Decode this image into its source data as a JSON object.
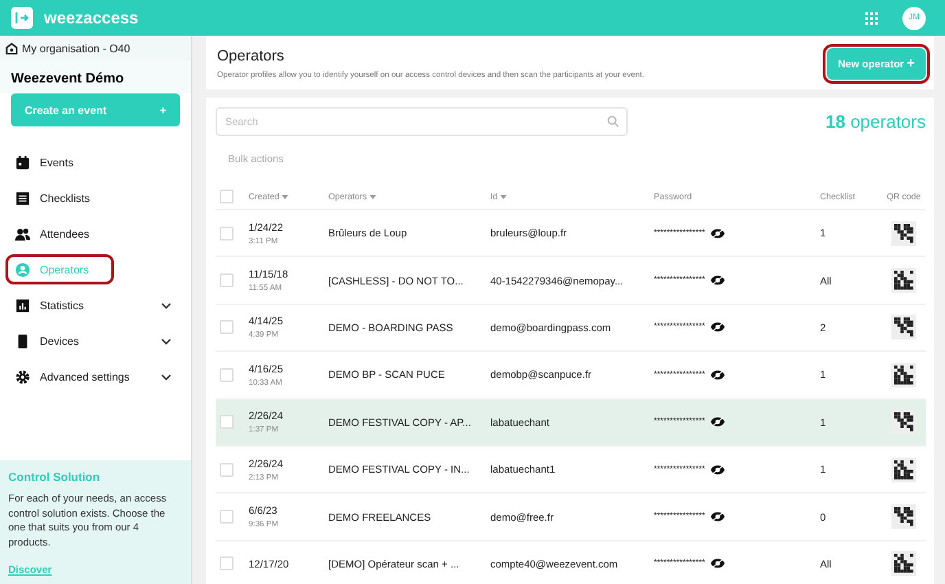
{
  "topbar": {
    "logo_text": "weezaccess",
    "avatar": "JM"
  },
  "sidebar": {
    "organisation": "My organisation - O40",
    "event_name": "Weezevent Démo",
    "create_button": "Create an event",
    "create_icon": "+",
    "items": [
      {
        "label": "Events",
        "kind": "link",
        "selected": false,
        "highlighted": false
      },
      {
        "label": "Checklists",
        "kind": "link",
        "selected": false,
        "highlighted": false
      },
      {
        "label": "Attendees",
        "kind": "link",
        "selected": false,
        "highlighted": false
      },
      {
        "label": "Operators",
        "kind": "link",
        "selected": true,
        "highlighted": true
      },
      {
        "label": "Statistics",
        "kind": "group",
        "selected": false,
        "highlighted": false
      },
      {
        "label": "Devices",
        "kind": "group",
        "selected": false,
        "highlighted": false
      },
      {
        "label": "Advanced settings",
        "kind": "group",
        "selected": false,
        "highlighted": false
      }
    ],
    "promo": {
      "title": "Control Solution",
      "text": "For each of your needs, an access control solution exists. Choose the one that suits you from our 4 products.",
      "link": "Discover"
    }
  },
  "header": {
    "title": "Operators",
    "description": "Operator profiles allow you to identify yourself on our access control devices and then scan the participants at your event.",
    "new_button": {
      "label": "New operator",
      "icon": "+",
      "highlighted": true
    }
  },
  "toolbar": {
    "search": {
      "placeholder": "Search"
    },
    "count": "18",
    "count_label": "operators",
    "bulk_actions": "Bulk actions"
  },
  "table": {
    "columns": [
      "Created",
      "Operators",
      "Id",
      "Password",
      "Checklist",
      "QR code"
    ],
    "header_checked": false,
    "rows": [
      {
        "date": "1/24/22",
        "time": "3:11 PM",
        "operator": "Brûleurs de Loup",
        "id": "bruleurs@loup.fr",
        "password": "****************",
        "checklist": "1",
        "checked": false,
        "selected": false
      },
      {
        "date": "11/15/18",
        "time": "11:55 AM",
        "operator": "[CASHLESS] - DO NOT TO...",
        "id": "40-1542279346@nemopay...",
        "password": "****************",
        "checklist": "All",
        "checked": false,
        "selected": false
      },
      {
        "date": "4/14/25",
        "time": "4:39 PM",
        "operator": "DEMO - BOARDING PASS",
        "id": "demo@boardingpass.com",
        "password": "****************",
        "checklist": "2",
        "checked": false,
        "selected": false
      },
      {
        "date": "4/16/25",
        "time": "10:33 AM",
        "operator": "DEMO BP - SCAN PUCE",
        "id": "demobp@scanpuce.fr",
        "password": "****************",
        "checklist": "1",
        "checked": false,
        "selected": false
      },
      {
        "date": "2/26/24",
        "time": "1:37 PM",
        "operator": "DEMO FESTIVAL COPY - AP...",
        "id": "labatuechant",
        "password": "****************",
        "checklist": "1",
        "checked": false,
        "selected": true
      },
      {
        "date": "2/26/24",
        "time": "2:13 PM",
        "operator": "DEMO FESTIVAL COPY - IN...",
        "id": "labatuechant1",
        "password": "****************",
        "checklist": "1",
        "checked": false,
        "selected": false
      },
      {
        "date": "6/6/23",
        "time": "9:36 PM",
        "operator": "DEMO FREELANCES",
        "id": "demo@free.fr",
        "password": "****************",
        "checklist": "0",
        "checked": false,
        "selected": false
      },
      {
        "date": "12/17/20",
        "operator": "[DEMO] Opérateur scan + ...",
        "id": "compte40@weezevent.com",
        "password": "****************",
        "checklist": "All",
        "checked": false,
        "selected": false
      }
    ]
  }
}
